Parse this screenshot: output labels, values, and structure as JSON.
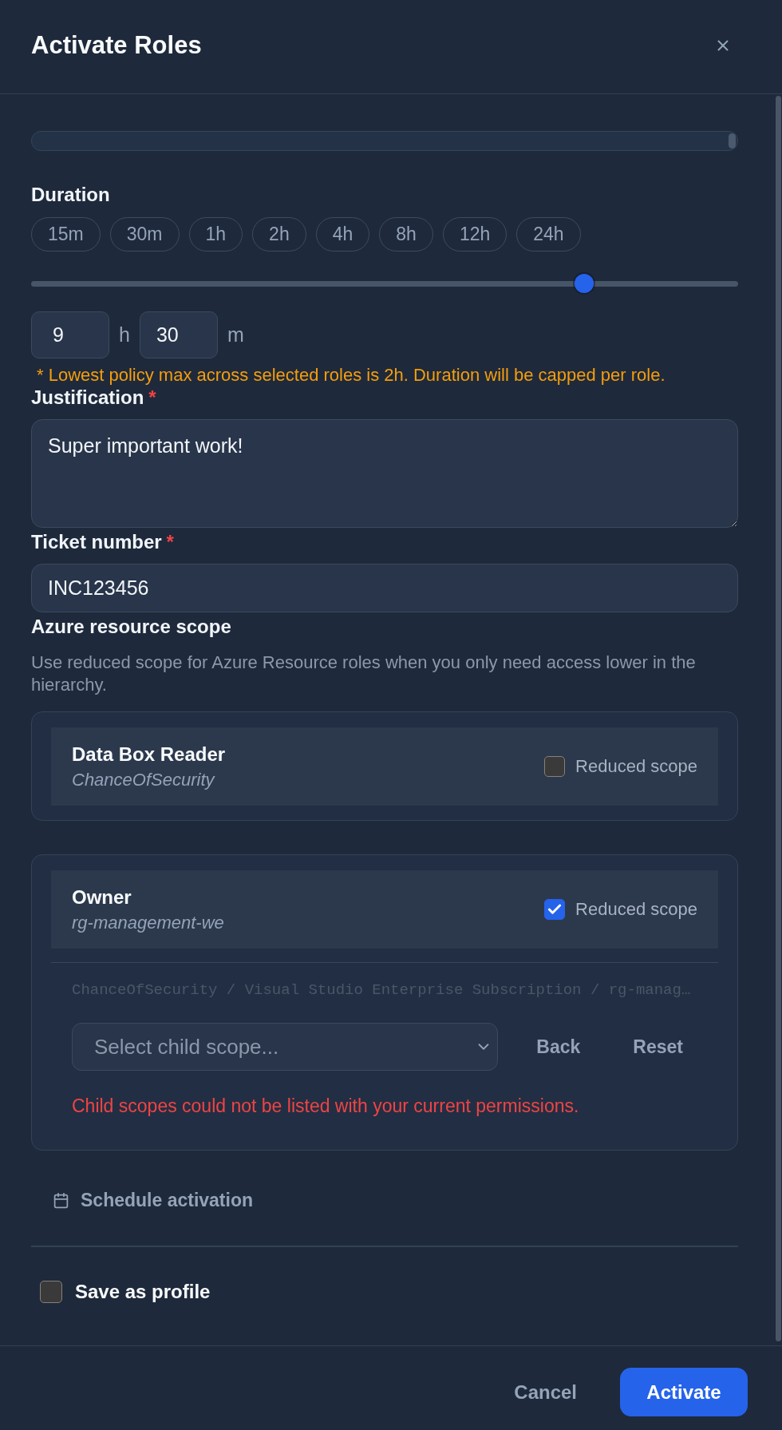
{
  "dialog": {
    "title": "Activate Roles"
  },
  "duration": {
    "label": "Duration",
    "presets": [
      {
        "label": "15m",
        "selected": false
      },
      {
        "label": "30m",
        "selected": false
      },
      {
        "label": "1h",
        "selected": false
      },
      {
        "label": "2h",
        "selected": false
      },
      {
        "label": "4h",
        "selected": false
      },
      {
        "label": "8h",
        "selected": false
      },
      {
        "label": "12h",
        "selected": false
      },
      {
        "label": "24h",
        "selected": false
      }
    ],
    "slider": {
      "level": 0.79
    },
    "hours": {
      "value": "9",
      "unit": "h"
    },
    "minutes": {
      "value": "30",
      "unit": "m"
    },
    "warning": "* Lowest policy max across selected roles is 2h. Duration will be capped per role."
  },
  "justification": {
    "label": "Justification",
    "required_mark": "*",
    "value": "Super important work!"
  },
  "ticket": {
    "label": "Ticket number",
    "required_mark": "*",
    "value": "INC123456"
  },
  "scope": {
    "title": "Azure resource scope",
    "help": "Use reduced scope for Azure Resource roles when you only need access lower in the hierarchy.",
    "roles": [
      {
        "name": "Data Box Reader",
        "resource": "ChanceOfSecurity",
        "option_label": "Reduced scope",
        "checked": false
      },
      {
        "name": "Owner",
        "resource": "rg-management-we",
        "option_label": "Reduced scope",
        "checked": true,
        "picker": {
          "path": "ChanceOfSecurity / Visual Studio Enterprise Subscription / rg-manag…",
          "select": {
            "placeholder": "Select child scope..."
          },
          "buttons": [
            "Back",
            "Reset"
          ],
          "error": "Child scopes could not be listed with your current permissions."
        }
      }
    ]
  },
  "schedule": {
    "label": "Schedule activation"
  },
  "save_profile": {
    "label": "Save as profile",
    "checked": false
  },
  "footer": {
    "buttons": [
      {
        "label": "Cancel",
        "kind": "secondary"
      },
      {
        "label": "Activate",
        "kind": "primary"
      }
    ]
  }
}
